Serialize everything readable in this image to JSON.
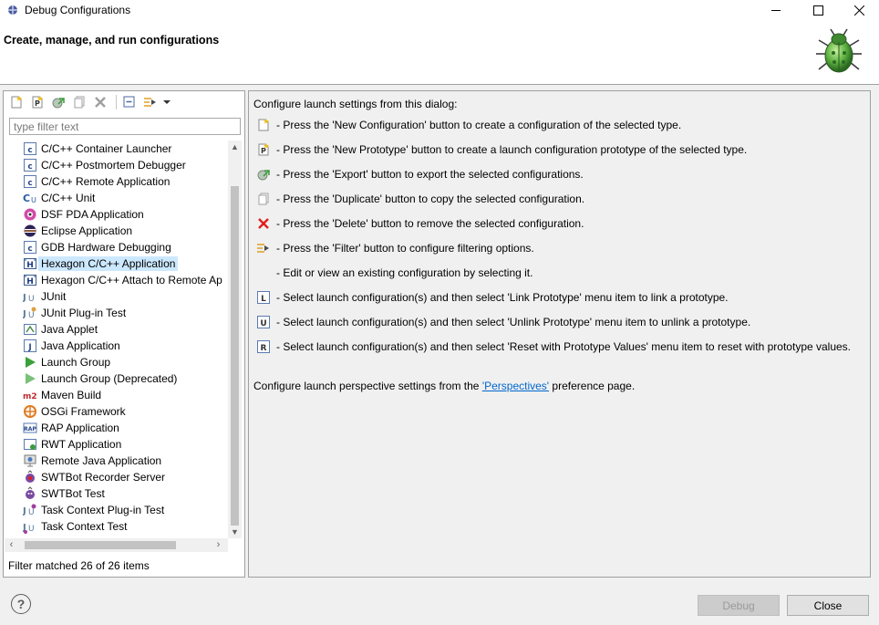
{
  "window": {
    "title": "Debug Configurations",
    "controls": {
      "minimize": "—",
      "maximize": "☐",
      "close": "✕"
    }
  },
  "header": {
    "title": "Create, manage, and run configurations",
    "icon": "bug-icon"
  },
  "toolbar": {
    "buttons": [
      {
        "name": "new-configuration-icon"
      },
      {
        "name": "new-prototype-icon"
      },
      {
        "name": "export-icon"
      },
      {
        "name": "duplicate-icon"
      },
      {
        "name": "delete-icon"
      },
      {
        "name": "collapse-all-icon"
      },
      {
        "name": "filter-icon"
      },
      {
        "name": "view-menu-chevron-icon"
      }
    ]
  },
  "filter": {
    "placeholder": "type filter text",
    "value": ""
  },
  "tree": {
    "items": [
      {
        "label": "C/C++ Container Launcher",
        "icon": "c-config-icon"
      },
      {
        "label": "C/C++ Postmortem Debugger",
        "icon": "c-config-icon"
      },
      {
        "label": "C/C++ Remote Application",
        "icon": "c-config-icon"
      },
      {
        "label": "C/C++ Unit",
        "icon": "c-unit-icon"
      },
      {
        "label": "DSF PDA Application",
        "icon": "dsf-icon"
      },
      {
        "label": "Eclipse Application",
        "icon": "eclipse-icon"
      },
      {
        "label": "GDB Hardware Debugging",
        "icon": "c-config-icon"
      },
      {
        "label": "Hexagon C/C++ Application",
        "icon": "hexagon-icon",
        "selected": true
      },
      {
        "label": "Hexagon C/C++ Attach to Remote Ap",
        "icon": "hexagon-icon"
      },
      {
        "label": "JUnit",
        "icon": "junit-icon"
      },
      {
        "label": "JUnit Plug-in Test",
        "icon": "junit-plugin-icon"
      },
      {
        "label": "Java Applet",
        "icon": "java-applet-icon"
      },
      {
        "label": "Java Application",
        "icon": "java-app-icon"
      },
      {
        "label": "Launch Group",
        "icon": "launch-group-icon"
      },
      {
        "label": "Launch Group (Deprecated)",
        "icon": "launch-group-deprecated-icon"
      },
      {
        "label": "Maven Build",
        "icon": "maven-icon"
      },
      {
        "label": "OSGi Framework",
        "icon": "osgi-icon"
      },
      {
        "label": "RAP Application",
        "icon": "rap-icon"
      },
      {
        "label": "RWT Application",
        "icon": "rwt-icon"
      },
      {
        "label": "Remote Java Application",
        "icon": "remote-java-icon"
      },
      {
        "label": "SWTBot Recorder Server",
        "icon": "swtbot-recorder-icon"
      },
      {
        "label": "SWTBot Test",
        "icon": "swtbot-icon"
      },
      {
        "label": "Task Context Plug-in Test",
        "icon": "task-context-plugin-icon"
      },
      {
        "label": "Task Context Test",
        "icon": "task-context-icon"
      }
    ]
  },
  "status": "Filter matched 26 of 26 items",
  "right": {
    "intro": "Configure launch settings from this dialog:",
    "rows": [
      {
        "icon": "new-configuration-icon",
        "text": "- Press the 'New Configuration' button to create a configuration of the selected type."
      },
      {
        "icon": "new-prototype-icon",
        "text": "- Press the 'New Prototype' button to create a launch configuration prototype of the selected type."
      },
      {
        "icon": "export-icon",
        "text": "- Press the 'Export' button to export the selected configurations."
      },
      {
        "icon": "duplicate-icon",
        "text": "- Press the 'Duplicate' button to copy the selected configuration."
      },
      {
        "icon": "delete-icon",
        "text": "- Press the 'Delete' button to remove the selected configuration."
      },
      {
        "icon": "filter-icon",
        "text": "- Press the 'Filter' button to configure filtering options."
      },
      {
        "icon": "",
        "text": "- Edit or view an existing configuration by selecting it."
      },
      {
        "icon": "link-prototype-icon",
        "text": "- Select launch configuration(s) and then select 'Link Prototype' menu item to link a prototype."
      },
      {
        "icon": "unlink-prototype-icon",
        "text": "- Select launch configuration(s) and then select 'Unlink Prototype' menu item to unlink a prototype."
      },
      {
        "icon": "reset-prototype-icon",
        "text": "- Select launch configuration(s) and then select 'Reset with Prototype Values' menu item to reset with prototype values."
      }
    ],
    "perspectives_prefix": "Configure launch perspective settings from the ",
    "perspectives_link": "'Perspectives'",
    "perspectives_suffix": " preference page."
  },
  "footer": {
    "help": "?",
    "debug_label": "Debug",
    "close_label": "Close"
  }
}
